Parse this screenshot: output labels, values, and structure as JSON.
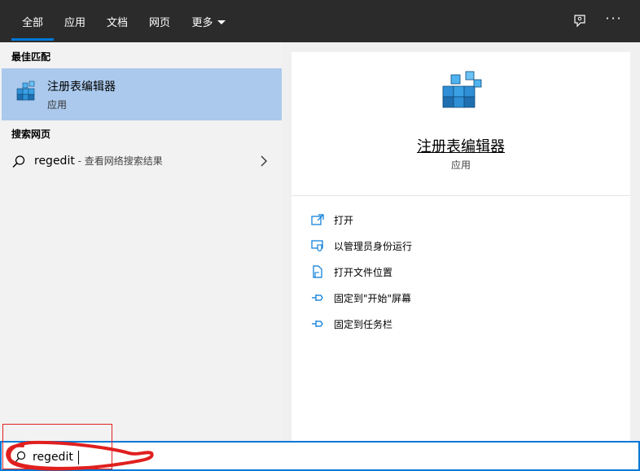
{
  "tabs": [
    {
      "label": "全部",
      "active": true
    },
    {
      "label": "应用",
      "active": false
    },
    {
      "label": "文档",
      "active": false
    },
    {
      "label": "网页",
      "active": false
    },
    {
      "label": "更多",
      "active": false
    }
  ],
  "top_icons": [
    "feedback-icon",
    "more-options-icon"
  ],
  "left": {
    "best_match_title": "最佳匹配",
    "best_match": {
      "name": "注册表编辑器",
      "type": "应用",
      "icon": "registry-editor-icon"
    },
    "web_title": "搜索网页",
    "web_result": {
      "query": "regedit",
      "hint": " - 查看网络搜索结果",
      "icon": "search-icon"
    }
  },
  "preview": {
    "name": "注册表编辑器",
    "type": "应用",
    "icon": "registry-editor-icon",
    "actions": [
      {
        "label": "打开",
        "icon": "open-icon"
      },
      {
        "label": "以管理员身份运行",
        "icon": "run-as-admin-icon"
      },
      {
        "label": "打开文件位置",
        "icon": "file-location-icon"
      },
      {
        "label": "固定到\"开始\"屏幕",
        "icon": "pin-icon"
      },
      {
        "label": "固定到任务栏",
        "icon": "pin-icon"
      }
    ]
  },
  "search": {
    "value": "regedit",
    "icon": "search-icon"
  },
  "colors": {
    "accent": "#0078d7",
    "selected": "#aac9ec",
    "topbar": "#2b2b2b",
    "annotation": "#e0201f"
  }
}
